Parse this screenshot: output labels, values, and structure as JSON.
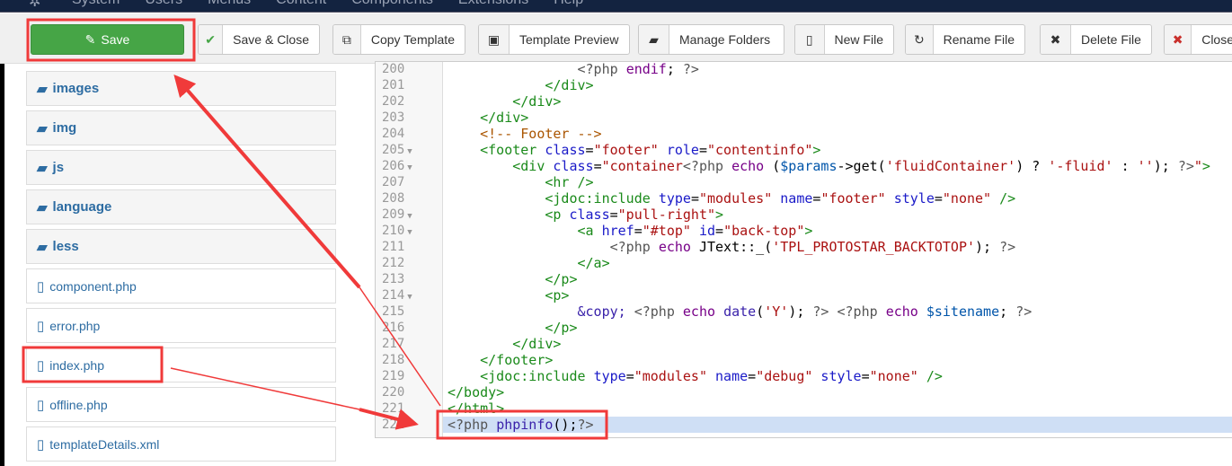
{
  "topnav": {
    "logo_icon": "joomla-logo-icon",
    "menu": [
      "System",
      "Users",
      "Menus",
      "Content",
      "Components",
      "Extensions",
      "Help"
    ]
  },
  "toolbar": {
    "buttons": [
      {
        "label": "Save",
        "icon": "edit-icon",
        "glyph": "✎"
      },
      {
        "label": "Save & Close",
        "icon": "check-icon",
        "glyph": "✔"
      },
      {
        "label": "Copy Template",
        "icon": "copy-icon",
        "glyph": "⧉"
      },
      {
        "label": "Template Preview",
        "icon": "image-icon",
        "glyph": "▣"
      },
      {
        "label": "Manage Folders",
        "icon": "folder-open-icon",
        "glyph": "▰"
      },
      {
        "label": "New File",
        "icon": "file-icon",
        "glyph": "▯"
      },
      {
        "label": "Rename File",
        "icon": "refresh-icon",
        "glyph": "↻"
      },
      {
        "label": "Delete File",
        "icon": "times-icon",
        "glyph": "✖"
      },
      {
        "label": "Close",
        "icon": "cancel-circle-icon",
        "glyph": "✖"
      }
    ]
  },
  "sidebar": {
    "items": [
      {
        "label": "images",
        "type": "folder"
      },
      {
        "label": "img",
        "type": "folder"
      },
      {
        "label": "js",
        "type": "folder"
      },
      {
        "label": "language",
        "type": "folder"
      },
      {
        "label": "less",
        "type": "folder"
      },
      {
        "label": "component.php",
        "type": "file"
      },
      {
        "label": "error.php",
        "type": "file"
      },
      {
        "label": "index.php",
        "type": "file"
      },
      {
        "label": "offline.php",
        "type": "file"
      },
      {
        "label": "templateDetails.xml",
        "type": "file"
      }
    ]
  },
  "colors": {
    "save": "#46a546",
    "link": "#2d6ca2",
    "annotation": "#f03a3a",
    "active_line": "#cfdff5"
  },
  "editor": {
    "active_line": "222",
    "lines": [
      {
        "n": "200",
        "tokens": [
          [
            "n",
            "                "
          ],
          [
            "p",
            "<?php "
          ],
          [
            "k",
            "endif"
          ],
          [
            "n",
            "; "
          ],
          [
            "p",
            "?>"
          ]
        ]
      },
      {
        "n": "201",
        "tokens": [
          [
            "n",
            "            "
          ],
          [
            "t",
            "</div>"
          ]
        ]
      },
      {
        "n": "202",
        "tokens": [
          [
            "n",
            "        "
          ],
          [
            "t",
            "</div>"
          ]
        ]
      },
      {
        "n": "203",
        "tokens": [
          [
            "n",
            "    "
          ],
          [
            "t",
            "</div>"
          ]
        ]
      },
      {
        "n": "204",
        "tokens": [
          [
            "n",
            "    "
          ],
          [
            "c",
            "<!-- Footer -->"
          ]
        ]
      },
      {
        "n": "205",
        "fold": true,
        "tokens": [
          [
            "n",
            "    "
          ],
          [
            "t",
            "<footer "
          ],
          [
            "a",
            "class"
          ],
          [
            "n",
            "="
          ],
          [
            "s",
            "\"footer\""
          ],
          [
            "a",
            " role"
          ],
          [
            "n",
            "="
          ],
          [
            "s",
            "\"contentinfo\""
          ],
          [
            "t",
            ">"
          ]
        ]
      },
      {
        "n": "206",
        "fold": true,
        "tokens": [
          [
            "n",
            "        "
          ],
          [
            "t",
            "<div "
          ],
          [
            "a",
            "class"
          ],
          [
            "n",
            "="
          ],
          [
            "s",
            "\"container"
          ],
          [
            "p",
            "<?php "
          ],
          [
            "k",
            "echo"
          ],
          [
            "n",
            " ("
          ],
          [
            "v",
            "$params"
          ],
          [
            "n",
            "->get("
          ],
          [
            "s",
            "'fluidContainer'"
          ],
          [
            "n",
            ") ? "
          ],
          [
            "s",
            "'-fluid'"
          ],
          [
            "n",
            " : "
          ],
          [
            "s",
            "''"
          ],
          [
            "n",
            "); "
          ],
          [
            "p",
            "?>"
          ],
          [
            "s",
            "\""
          ],
          [
            "t",
            ">"
          ]
        ]
      },
      {
        "n": "207",
        "tokens": [
          [
            "n",
            "            "
          ],
          [
            "t",
            "<hr />"
          ]
        ]
      },
      {
        "n": "208",
        "tokens": [
          [
            "n",
            "            "
          ],
          [
            "t",
            "<jdoc:include "
          ],
          [
            "a",
            "type"
          ],
          [
            "n",
            "="
          ],
          [
            "s",
            "\"modules\""
          ],
          [
            "a",
            " name"
          ],
          [
            "n",
            "="
          ],
          [
            "s",
            "\"footer\""
          ],
          [
            "a",
            " style"
          ],
          [
            "n",
            "="
          ],
          [
            "s",
            "\"none\""
          ],
          [
            "t",
            " />"
          ]
        ]
      },
      {
        "n": "209",
        "fold": true,
        "tokens": [
          [
            "n",
            "            "
          ],
          [
            "t",
            "<p "
          ],
          [
            "a",
            "class"
          ],
          [
            "n",
            "="
          ],
          [
            "s",
            "\"pull-right\""
          ],
          [
            "t",
            ">"
          ]
        ]
      },
      {
        "n": "210",
        "fold": true,
        "tokens": [
          [
            "n",
            "                "
          ],
          [
            "t",
            "<a "
          ],
          [
            "a",
            "href"
          ],
          [
            "n",
            "="
          ],
          [
            "s",
            "\"#top\""
          ],
          [
            "a",
            " id"
          ],
          [
            "n",
            "="
          ],
          [
            "s",
            "\"back-top\""
          ],
          [
            "t",
            ">"
          ]
        ]
      },
      {
        "n": "211",
        "tokens": [
          [
            "n",
            "                    "
          ],
          [
            "p",
            "<?php "
          ],
          [
            "k",
            "echo"
          ],
          [
            "n",
            " JText::_("
          ],
          [
            "s",
            "'TPL_PROTOSTAR_BACKTOTOP'"
          ],
          [
            "n",
            "); "
          ],
          [
            "p",
            "?>"
          ]
        ]
      },
      {
        "n": "212",
        "tokens": [
          [
            "n",
            "                "
          ],
          [
            "t",
            "</a>"
          ]
        ]
      },
      {
        "n": "213",
        "tokens": [
          [
            "n",
            "            "
          ],
          [
            "t",
            "</p>"
          ]
        ]
      },
      {
        "n": "214",
        "fold": true,
        "tokens": [
          [
            "n",
            "            "
          ],
          [
            "t",
            "<p>"
          ]
        ]
      },
      {
        "n": "215",
        "tokens": [
          [
            "n",
            "                "
          ],
          [
            "e",
            "&copy;"
          ],
          [
            "n",
            " "
          ],
          [
            "p",
            "<?php "
          ],
          [
            "k",
            "echo"
          ],
          [
            "n",
            " "
          ],
          [
            "e",
            "date"
          ],
          [
            "n",
            "("
          ],
          [
            "s",
            "'Y'"
          ],
          [
            "n",
            "); "
          ],
          [
            "p",
            "?> <?php "
          ],
          [
            "k",
            "echo"
          ],
          [
            "n",
            " "
          ],
          [
            "v",
            "$sitename"
          ],
          [
            "n",
            "; "
          ],
          [
            "p",
            "?>"
          ]
        ]
      },
      {
        "n": "216",
        "tokens": [
          [
            "n",
            "            "
          ],
          [
            "t",
            "</p>"
          ]
        ]
      },
      {
        "n": "217",
        "tokens": [
          [
            "n",
            "        "
          ],
          [
            "t",
            "</div>"
          ]
        ]
      },
      {
        "n": "218",
        "tokens": [
          [
            "n",
            "    "
          ],
          [
            "t",
            "</footer>"
          ]
        ]
      },
      {
        "n": "219",
        "tokens": [
          [
            "n",
            "    "
          ],
          [
            "t",
            "<jdoc:include "
          ],
          [
            "a",
            "type"
          ],
          [
            "n",
            "="
          ],
          [
            "s",
            "\"modules\""
          ],
          [
            "a",
            " name"
          ],
          [
            "n",
            "="
          ],
          [
            "s",
            "\"debug\""
          ],
          [
            "a",
            " style"
          ],
          [
            "n",
            "="
          ],
          [
            "s",
            "\"none\""
          ],
          [
            "t",
            " />"
          ]
        ]
      },
      {
        "n": "220",
        "tokens": [
          [
            "t",
            "</body>"
          ]
        ]
      },
      {
        "n": "221",
        "tokens": [
          [
            "t",
            "</html>"
          ]
        ]
      },
      {
        "n": "222",
        "tokens": [
          [
            "p",
            "<?php "
          ],
          [
            "e",
            "phpinfo"
          ],
          [
            "n",
            "();"
          ],
          [
            "p",
            "?>"
          ]
        ]
      }
    ]
  }
}
